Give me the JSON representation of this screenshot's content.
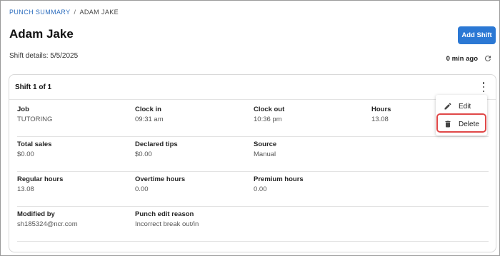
{
  "breadcrumb": {
    "parent": "PUNCH SUMMARY",
    "separator": "/",
    "current": "ADAM JAKE"
  },
  "page": {
    "title": "Adam Jake",
    "add_button": "Add Shift",
    "shift_details": "Shift details: 5/5/2025",
    "updated": "0 min ago"
  },
  "card": {
    "title": "Shift 1 of 1"
  },
  "fields": {
    "job": {
      "label": "Job",
      "value": "TUTORING"
    },
    "clock_in": {
      "label": "Clock in",
      "value": "09:31 am"
    },
    "clock_out": {
      "label": "Clock out",
      "value": "10:36 pm"
    },
    "hours": {
      "label": "Hours",
      "value": "13.08"
    },
    "total_sales": {
      "label": "Total sales",
      "value": "$0.00"
    },
    "declared_tips": {
      "label": "Declared tips",
      "value": "$0.00"
    },
    "source": {
      "label": "Source",
      "value": "Manual"
    },
    "regular_hours": {
      "label": "Regular hours",
      "value": "13.08"
    },
    "overtime_hours": {
      "label": "Overtime hours",
      "value": "0.00"
    },
    "premium_hours": {
      "label": "Premium hours",
      "value": "0.00"
    },
    "modified_by": {
      "label": "Modified by",
      "value": "sh185324@ncr.com"
    },
    "punch_edit_reason": {
      "label": "Punch edit reason",
      "value": "Incorrect break out/in"
    }
  },
  "menu": {
    "edit": "Edit",
    "delete": "Delete"
  },
  "colors": {
    "primary": "#2b78d4",
    "link": "#2f6fbf",
    "highlight": "#e04848"
  },
  "icons": {
    "refresh": "refresh-icon",
    "more": "more-vertical-icon",
    "edit": "pencil-icon",
    "delete": "trash-icon"
  }
}
